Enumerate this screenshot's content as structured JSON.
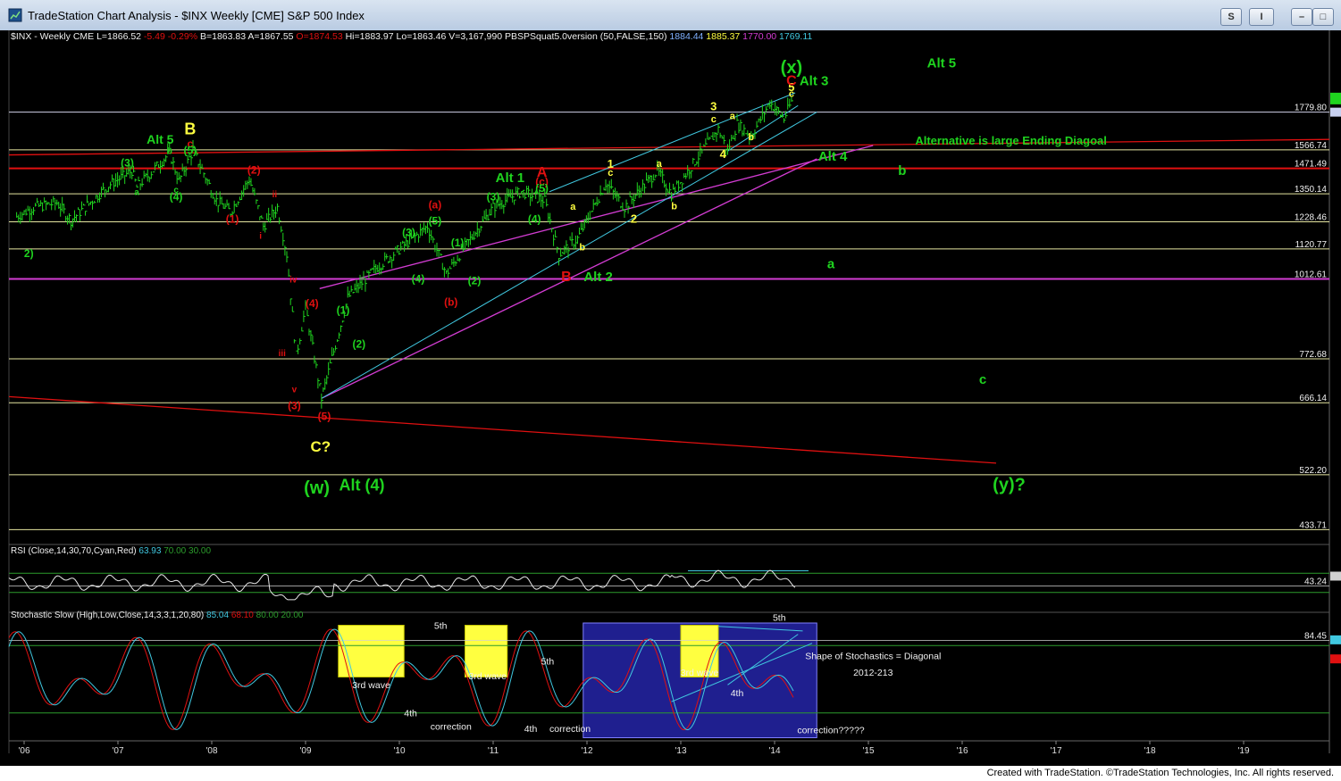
{
  "window": {
    "title": "TradeStation Chart Analysis - $INX Weekly [CME] S&P 500 Index",
    "btn_s": "S",
    "btn_i": "I",
    "btn_min": "–",
    "btn_max": "□",
    "btn_close": "✕"
  },
  "header": {
    "symbol": "$INX - Weekly  CME",
    "last": "L=1866.52",
    "change": "-5.49",
    "pct": "-0.29%",
    "bid": "B=1863.83",
    "ask": "A=1867.55",
    "open": "O=1874.53",
    "hi": "Hi=1883.97",
    "lo": "Lo=1863.46",
    "vol": "V=3,167,990",
    "study": "PBSPSquat5.0version (50,FALSE,150)",
    "v1": "1884.44",
    "v2": "1885.37",
    "v3": "1770.00",
    "v4": "1769.11"
  },
  "rsi_header": {
    "name": "RSI (Close,14,30,70,Cyan,Red)",
    "v": "63.93",
    "ob": "70.00",
    "os": "30.00"
  },
  "stoch_header": {
    "name": "Stochastic Slow (High,Low,Close,14,3,3,1,20,80)",
    "k": "85.04",
    "d": "68.10",
    "ob": "80.00",
    "os": "20.00"
  },
  "footer": {
    "text": "Created with TradeStation. ©TradeStation Technologies, Inc. All rights reserved."
  },
  "colors": {
    "green": "#1fd41f",
    "red": "#e01010",
    "yellow": "#ffff40",
    "magenta": "#d23cd2",
    "cyan": "#40c8e0",
    "hline": "#e6e6a0"
  },
  "chart_data": {
    "type": "ohlc",
    "title": "$INX - Weekly CME",
    "x_ticks": [
      "'06",
      "'07",
      "'08",
      "'09",
      "'10",
      "'11",
      "'12",
      "'13",
      "'14",
      "'15",
      "'16",
      "'17",
      "'18",
      "'19"
    ],
    "price_levels": [
      {
        "value": 1779.8,
        "label": "1779.80",
        "color": "#d0d0e8"
      },
      {
        "value": 1566.74,
        "label": "1566.74",
        "color": "#e6e6a0"
      },
      {
        "value": 1471.49,
        "label": "1471.49",
        "color": "#e01010"
      },
      {
        "value": 1350.14,
        "label": "1350.14",
        "color": "#e6e6a0"
      },
      {
        "value": 1228.46,
        "label": "1228.46",
        "color": "#e6e6a0"
      },
      {
        "value": 1120.77,
        "label": "1120.77",
        "color": "#e6e6a0"
      },
      {
        "value": 1012.61,
        "label": "1012.61",
        "color": "#d23cd2"
      },
      {
        "value": 772.68,
        "label": "772.68",
        "color": "#e6e6a0"
      },
      {
        "value": 666.14,
        "label": "666.14",
        "color": "#e6e6a0"
      },
      {
        "value": 522.2,
        "label": "522.20",
        "color": "#e6e6a0"
      },
      {
        "value": 433.71,
        "label": "433.71",
        "color": "#e6e6a0"
      }
    ],
    "price_path": [
      {
        "t": 2005.92,
        "p": 1250
      },
      {
        "t": 2006.1,
        "p": 1290
      },
      {
        "t": 2006.35,
        "p": 1310
      },
      {
        "t": 2006.5,
        "p": 1235
      },
      {
        "t": 2006.9,
        "p": 1390
      },
      {
        "t": 2007.15,
        "p": 1460
      },
      {
        "t": 2007.2,
        "p": 1380
      },
      {
        "t": 2007.55,
        "p": 1550
      },
      {
        "t": 2007.65,
        "p": 1410
      },
      {
        "t": 2007.8,
        "p": 1565
      },
      {
        "t": 2008.05,
        "p": 1320
      },
      {
        "t": 2008.2,
        "p": 1270
      },
      {
        "t": 2008.4,
        "p": 1420
      },
      {
        "t": 2008.55,
        "p": 1210
      },
      {
        "t": 2008.7,
        "p": 1290
      },
      {
        "t": 2008.8,
        "p": 1100
      },
      {
        "t": 2008.9,
        "p": 780
      },
      {
        "t": 2009.0,
        "p": 920
      },
      {
        "t": 2009.17,
        "p": 676
      },
      {
        "t": 2009.45,
        "p": 950
      },
      {
        "t": 2009.75,
        "p": 1050
      },
      {
        "t": 2010.3,
        "p": 1210
      },
      {
        "t": 2010.5,
        "p": 1030
      },
      {
        "t": 2010.7,
        "p": 1130
      },
      {
        "t": 2011.0,
        "p": 1290
      },
      {
        "t": 2011.3,
        "p": 1360
      },
      {
        "t": 2011.55,
        "p": 1320
      },
      {
        "t": 2011.7,
        "p": 1100
      },
      {
        "t": 2011.9,
        "p": 1160
      },
      {
        "t": 2012.2,
        "p": 1400
      },
      {
        "t": 2012.4,
        "p": 1290
      },
      {
        "t": 2012.75,
        "p": 1460
      },
      {
        "t": 2012.9,
        "p": 1350
      },
      {
        "t": 2013.4,
        "p": 1680
      },
      {
        "t": 2013.5,
        "p": 1560
      },
      {
        "t": 2013.6,
        "p": 1710
      },
      {
        "t": 2013.75,
        "p": 1640
      },
      {
        "t": 2013.95,
        "p": 1840
      },
      {
        "t": 2014.1,
        "p": 1740
      },
      {
        "t": 2014.2,
        "p": 1870
      }
    ],
    "rsi_last": 63.93,
    "stoch_k_last": 85.04,
    "stoch_d_last": 68.1
  },
  "wave_labels": [
    {
      "text": "Alt 5",
      "t": 2007.45,
      "p": 1600,
      "color": "#1fd41f",
      "size": 14
    },
    {
      "text": "B",
      "t": 2007.77,
      "p": 1650,
      "color": "#ffff40",
      "size": 18
    },
    {
      "text": "c",
      "t": 2007.77,
      "p": 1580,
      "color": "#e01010",
      "size": 12
    },
    {
      "text": "(5)",
      "t": 2007.77,
      "p": 1545,
      "color": "#1fd41f",
      "size": 12
    },
    {
      "text": "b",
      "t": 2007.55,
      "p": 1545,
      "color": "#1fd41f",
      "size": 10
    },
    {
      "text": "(3)",
      "t": 2007.1,
      "p": 1480,
      "color": "#1fd41f",
      "size": 12
    },
    {
      "text": "a",
      "t": 2007.2,
      "p": 1345,
      "color": "#1fd41f",
      "size": 10
    },
    {
      "text": "c",
      "t": 2007.62,
      "p": 1355,
      "color": "#1fd41f",
      "size": 10
    },
    {
      "text": "(4)",
      "t": 2007.62,
      "p": 1320,
      "color": "#1fd41f",
      "size": 12
    },
    {
      "text": "(2)",
      "t": 2008.45,
      "p": 1445,
      "color": "#e01010",
      "size": 12
    },
    {
      "text": "(1)",
      "t": 2008.22,
      "p": 1225,
      "color": "#e01010",
      "size": 12
    },
    {
      "text": "ii",
      "t": 2008.67,
      "p": 1335,
      "color": "#e01010",
      "size": 10
    },
    {
      "text": "i",
      "t": 2008.52,
      "p": 1160,
      "color": "#e01010",
      "size": 10
    },
    {
      "text": "2)",
      "t": 2006.05,
      "p": 1090,
      "color": "#1fd41f",
      "size": 12
    },
    {
      "text": "iv",
      "t": 2008.87,
      "p": 1000,
      "color": "#e01010",
      "size": 10
    },
    {
      "text": "(4)",
      "t": 2009.07,
      "p": 920,
      "color": "#e01010",
      "size": 12
    },
    {
      "text": "iii",
      "t": 2008.75,
      "p": 780,
      "color": "#e01010",
      "size": 10
    },
    {
      "text": "v",
      "t": 2008.88,
      "p": 690,
      "color": "#e01010",
      "size": 10
    },
    {
      "text": "(3)",
      "t": 2008.88,
      "p": 652,
      "color": "#e01010",
      "size": 12
    },
    {
      "text": "(5)",
      "t": 2009.2,
      "p": 628,
      "color": "#e01010",
      "size": 12
    },
    {
      "text": "C?",
      "t": 2009.16,
      "p": 565,
      "color": "#ffff40",
      "size": 17
    },
    {
      "text": "(w)",
      "t": 2009.12,
      "p": 490,
      "color": "#1fd41f",
      "size": 20
    },
    {
      "text": "Alt (4)",
      "t": 2009.6,
      "p": 495,
      "color": "#1fd41f",
      "size": 18
    },
    {
      "text": "(1)",
      "t": 2009.4,
      "p": 900,
      "color": "#1fd41f",
      "size": 12
    },
    {
      "text": "(2)",
      "t": 2009.57,
      "p": 802,
      "color": "#1fd41f",
      "size": 12
    },
    {
      "text": "(3)",
      "t": 2010.1,
      "p": 1170,
      "color": "#1fd41f",
      "size": 12
    },
    {
      "text": "(4)",
      "t": 2010.2,
      "p": 1000,
      "color": "#1fd41f",
      "size": 12
    },
    {
      "text": "(a)",
      "t": 2010.38,
      "p": 1285,
      "color": "#e01010",
      "size": 12
    },
    {
      "text": "(5)",
      "t": 2010.38,
      "p": 1218,
      "color": "#1fd41f",
      "size": 12
    },
    {
      "text": "(b)",
      "t": 2010.55,
      "p": 925,
      "color": "#e01010",
      "size": 12
    },
    {
      "text": "(1)",
      "t": 2010.62,
      "p": 1130,
      "color": "#1fd41f",
      "size": 12
    },
    {
      "text": "(2)",
      "t": 2010.8,
      "p": 995,
      "color": "#1fd41f",
      "size": 12
    },
    {
      "text": "Alt 1",
      "t": 2011.18,
      "p": 1405,
      "color": "#1fd41f",
      "size": 15
    },
    {
      "text": "(3)",
      "t": 2011.0,
      "p": 1320,
      "color": "#1fd41f",
      "size": 12
    },
    {
      "text": "A",
      "t": 2011.52,
      "p": 1430,
      "color": "#e01010",
      "size": 16
    },
    {
      "text": "(c)",
      "t": 2011.52,
      "p": 1390,
      "color": "#e01010",
      "size": 12
    },
    {
      "text": "(5)",
      "t": 2011.52,
      "p": 1358,
      "color": "#1fd41f",
      "size": 12
    },
    {
      "text": "(4)",
      "t": 2011.44,
      "p": 1225,
      "color": "#1fd41f",
      "size": 12
    },
    {
      "text": "B",
      "t": 2011.78,
      "p": 1005,
      "color": "#e01010",
      "size": 16
    },
    {
      "text": "Alt 2",
      "t": 2012.12,
      "p": 1005,
      "color": "#1fd41f",
      "size": 15
    },
    {
      "text": "a",
      "t": 2011.85,
      "p": 1280,
      "color": "#ffff40",
      "size": 11
    },
    {
      "text": "b",
      "t": 2011.95,
      "p": 1115,
      "color": "#ffff40",
      "size": 11
    },
    {
      "text": "1",
      "t": 2012.25,
      "p": 1475,
      "color": "#ffff40",
      "size": 13
    },
    {
      "text": "c",
      "t": 2012.25,
      "p": 1435,
      "color": "#ffff40",
      "size": 11
    },
    {
      "text": "2",
      "t": 2012.5,
      "p": 1225,
      "color": "#ffff40",
      "size": 13
    },
    {
      "text": "a",
      "t": 2012.77,
      "p": 1478,
      "color": "#ffff40",
      "size": 11
    },
    {
      "text": "b",
      "t": 2012.93,
      "p": 1282,
      "color": "#ffff40",
      "size": 11
    },
    {
      "text": "3",
      "t": 2013.35,
      "p": 1790,
      "color": "#ffff40",
      "size": 13
    },
    {
      "text": "c",
      "t": 2013.35,
      "p": 1720,
      "color": "#ffff40",
      "size": 11
    },
    {
      "text": "a",
      "t": 2013.55,
      "p": 1738,
      "color": "#ffff40",
      "size": 11
    },
    {
      "text": "b",
      "t": 2013.75,
      "p": 1620,
      "color": "#ffff40",
      "size": 11
    },
    {
      "text": "4",
      "t": 2013.45,
      "p": 1525,
      "color": "#ffff40",
      "size": 13
    },
    {
      "text": "5",
      "t": 2014.18,
      "p": 1910,
      "color": "#ffff40",
      "size": 13
    },
    {
      "text": "c",
      "t": 2014.18,
      "p": 1875,
      "color": "#ffff40",
      "size": 11
    },
    {
      "text": "C",
      "t": 2014.18,
      "p": 1950,
      "color": "#e01010",
      "size": 16
    },
    {
      "text": "Alt 3",
      "t": 2014.42,
      "p": 1950,
      "color": "#1fd41f",
      "size": 15
    },
    {
      "text": "(x)",
      "t": 2014.18,
      "p": 2030,
      "color": "#1fd41f",
      "size": 20
    },
    {
      "text": "Alt 5",
      "t": 2015.78,
      "p": 2070,
      "color": "#1fd41f",
      "size": 15
    },
    {
      "text": "Alternative is large Ending Diagoal",
      "t": 2016.52,
      "p": 1595,
      "color": "#1fd41f",
      "size": 13
    },
    {
      "text": "Alt 4",
      "t": 2014.62,
      "p": 1510,
      "color": "#1fd41f",
      "size": 15
    },
    {
      "text": "b",
      "t": 2015.36,
      "p": 1440,
      "color": "#1fd41f",
      "size": 15
    },
    {
      "text": "a",
      "t": 2014.6,
      "p": 1050,
      "color": "#1fd41f",
      "size": 15
    },
    {
      "text": "c",
      "t": 2016.22,
      "p": 710,
      "color": "#1fd41f",
      "size": 15
    },
    {
      "text": "(y)?",
      "t": 2016.5,
      "p": 495,
      "color": "#1fd41f",
      "size": 20
    }
  ],
  "stoch_annotations": [
    {
      "text": "3rd wave",
      "t": 2009.7,
      "v": 42,
      "color": "#f0f0f0"
    },
    {
      "text": "5th",
      "t": 2010.44,
      "v": 95,
      "color": "#f0f0f0"
    },
    {
      "text": "4th",
      "t": 2010.12,
      "v": 17,
      "color": "#f0f0f0"
    },
    {
      "text": "correction",
      "t": 2010.55,
      "v": 5,
      "color": "#f0f0f0"
    },
    {
      "text": "3rd wave",
      "t": 2010.94,
      "v": 50,
      "color": "#f0f0f0"
    },
    {
      "text": "5th",
      "t": 2011.58,
      "v": 63,
      "color": "#f0f0f0"
    },
    {
      "text": "4th",
      "t": 2011.4,
      "v": 3,
      "color": "#f0f0f0"
    },
    {
      "text": "correction",
      "t": 2011.82,
      "v": 3,
      "color": "#f0f0f0"
    },
    {
      "text": "3rd wave",
      "t": 2013.2,
      "v": 53,
      "color": "#f0f0f0"
    },
    {
      "text": "4th",
      "t": 2013.6,
      "v": 35,
      "color": "#f0f0f0"
    },
    {
      "text": "5th",
      "t": 2014.05,
      "v": 102,
      "color": "#f0f0f0"
    },
    {
      "text": "Shape of Stochastics = Diagonal",
      "t": 2015.05,
      "v": 68,
      "color": "#f0f0f0"
    },
    {
      "text": "2012-213",
      "t": 2015.05,
      "v": 53,
      "color": "#f0f0f0"
    },
    {
      "text": "correction?????",
      "t": 2014.6,
      "v": 2,
      "color": "#f0f0f0"
    }
  ]
}
